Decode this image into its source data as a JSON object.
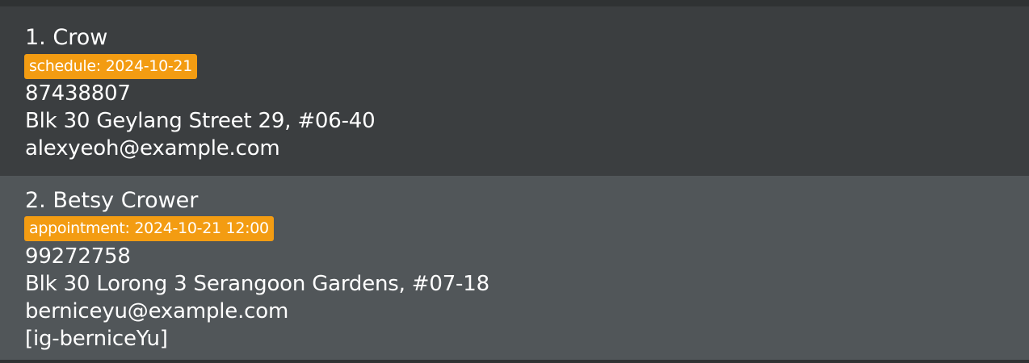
{
  "persons": [
    {
      "index": "1.",
      "name": "Crow",
      "tag": "schedule: 2024-10-21",
      "phone": "87438807",
      "address": "Blk 30 Geylang Street 29, #06-40",
      "email": "alexyeoh@example.com"
    },
    {
      "index": "2.",
      "name": "Betsy Crower",
      "tag": "appointment: 2024-10-21 12:00",
      "phone": "99272758",
      "address": "Blk 30 Lorong 3 Serangoon Gardens, #07-18",
      "email": "berniceyu@example.com",
      "social": "[ig-berniceYu]"
    }
  ],
  "colors": {
    "tag_background": "#f39c12",
    "card_dark": "#3b3e40",
    "card_light": "#515659",
    "text": "#ffffff"
  }
}
